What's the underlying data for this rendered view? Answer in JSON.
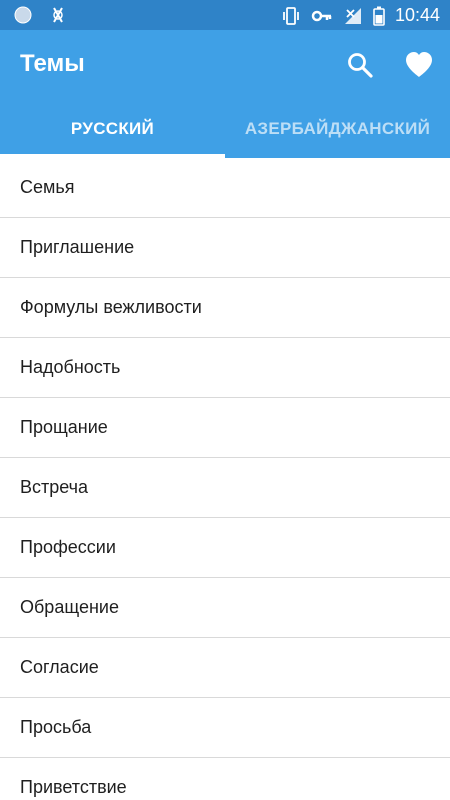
{
  "status_bar": {
    "time": "10:44",
    "icons": [
      "circle-notification-icon",
      "debug-icon",
      "vibrate-icon",
      "vpn-key-icon",
      "signal-icon",
      "battery-icon"
    ]
  },
  "app_bar": {
    "title": "Темы",
    "actions": [
      "search-icon",
      "heart-icon"
    ],
    "background": "#3fa0e6",
    "status_color": "#2f83c8"
  },
  "tabs": [
    {
      "label": "РУССКИЙ",
      "selected": true
    },
    {
      "label": "АЗЕРБАЙДЖАНСКИЙ",
      "selected": false
    }
  ],
  "topics": [
    "Семья",
    "Приглашение",
    "Формулы вежливости",
    "Надобность",
    "Прощание",
    "Встреча",
    "Профессии",
    "Обращение",
    "Согласие",
    "Просьба",
    "Приветствие"
  ]
}
